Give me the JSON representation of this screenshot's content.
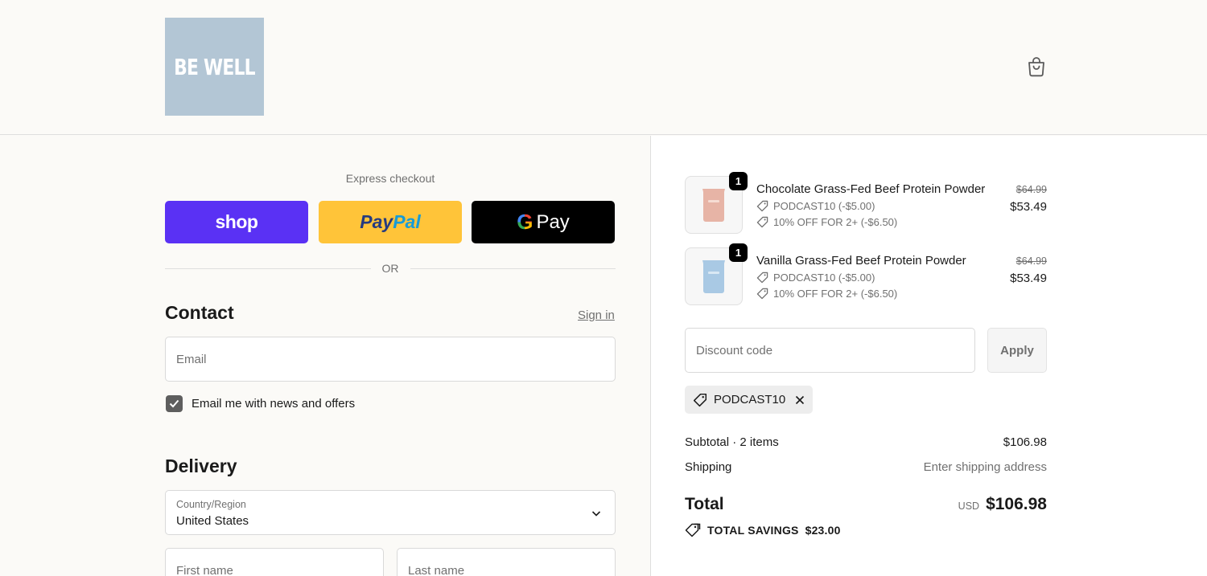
{
  "header": {
    "logo_text": "BE WELL"
  },
  "express": {
    "label": "Express checkout",
    "shop_label": "shop",
    "paypal_part1": "Pay",
    "paypal_part2": "Pal",
    "gpay_g": "G",
    "gpay_label": "Pay",
    "or_label": "OR"
  },
  "contact": {
    "title": "Contact",
    "sign_in": "Sign in",
    "email_placeholder": "Email",
    "newsletter_label": "Email me with news and offers",
    "newsletter_checked": true
  },
  "delivery": {
    "title": "Delivery",
    "country_label": "Country/Region",
    "country_value": "United States",
    "first_name_placeholder": "First name",
    "last_name_placeholder": "Last name"
  },
  "cart": {
    "items": [
      {
        "name": "Chocolate Grass-Fed Beef Protein Powder",
        "quantity": "1",
        "discounts": [
          "PODCAST10 (-$5.00)",
          "10% OFF FOR 2+ (-$6.50)"
        ],
        "original_price": "$64.99",
        "price": "$53.49",
        "color": "#e7b4a6"
      },
      {
        "name": "Vanilla Grass-Fed Beef Protein Powder",
        "quantity": "1",
        "discounts": [
          "PODCAST10 (-$5.00)",
          "10% OFF FOR 2+ (-$6.50)"
        ],
        "original_price": "$64.99",
        "price": "$53.49",
        "color": "#a9c9e4"
      }
    ],
    "discount_placeholder": "Discount code",
    "apply_label": "Apply",
    "applied_code": "PODCAST10",
    "subtotal_label": "Subtotal · 2 items",
    "subtotal_value": "$106.98",
    "shipping_label": "Shipping",
    "shipping_value": "Enter shipping address",
    "total_label": "Total",
    "currency": "USD",
    "total_value": "$106.98",
    "savings_label": "TOTAL SAVINGS",
    "savings_value": "$23.00"
  },
  "colors": {
    "shop_pay": "#5a31f4",
    "paypal": "#ffc439",
    "gpay": "#000000",
    "logo_bg": "#b3c6d5"
  }
}
